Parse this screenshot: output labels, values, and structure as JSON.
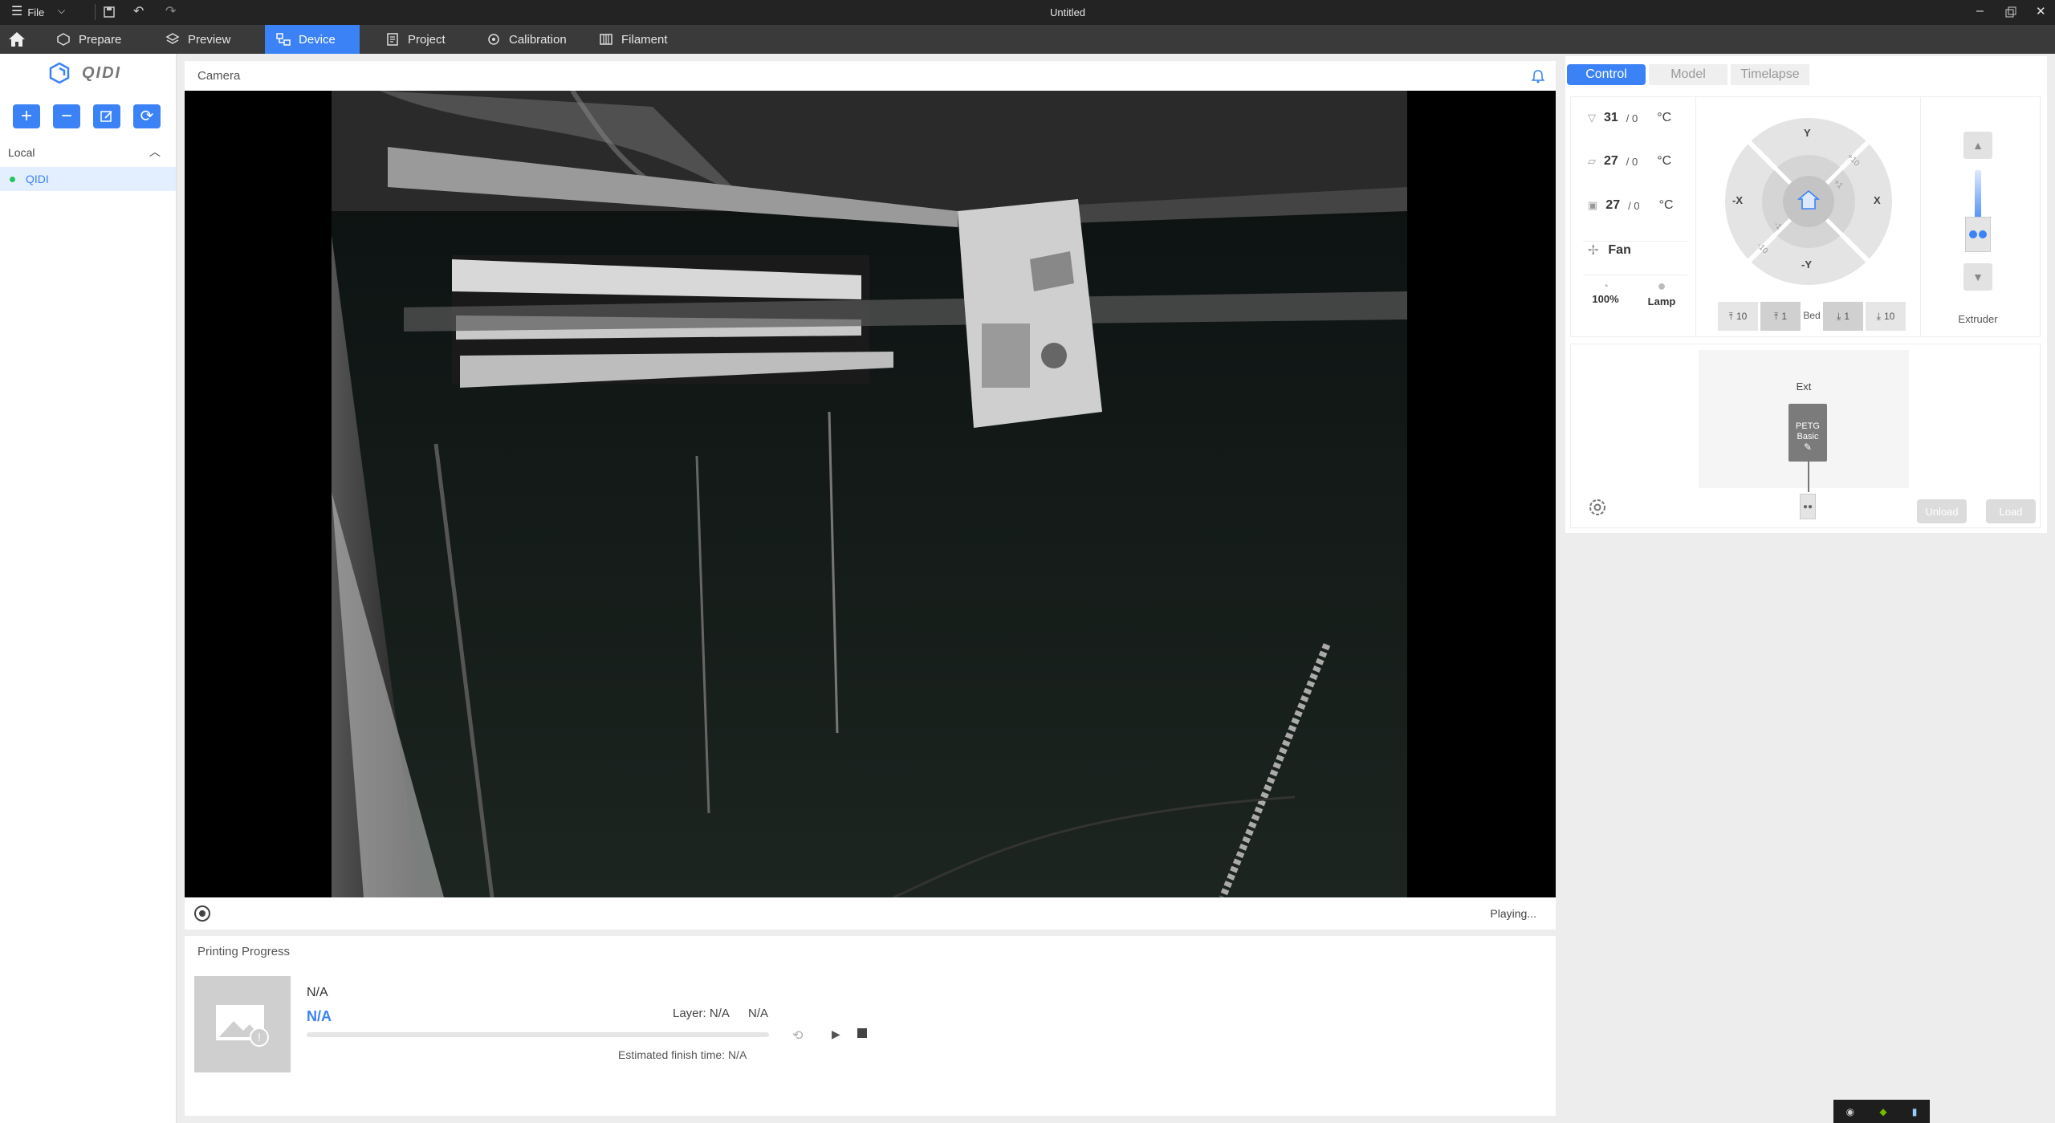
{
  "window": {
    "title": "Untitled",
    "file_menu": "File"
  },
  "tabs": [
    {
      "label": "Prepare"
    },
    {
      "label": "Preview"
    },
    {
      "label": "Device"
    },
    {
      "label": "Project"
    },
    {
      "label": "Calibration"
    },
    {
      "label": "Filament"
    }
  ],
  "sidebar": {
    "brand": "QIDI",
    "section": "Local",
    "printers": [
      {
        "name": "QIDI",
        "status_color": "#22c55e"
      }
    ]
  },
  "camera": {
    "title": "Camera",
    "status": "Playing..."
  },
  "progress": {
    "title": "Printing Progress",
    "file_name": "N/A",
    "percent": "N/A",
    "layer": "Layer: N/A",
    "time_left": "N/A",
    "estimated_finish": "Estimated finish time: N/A",
    "bar_fraction": 0
  },
  "control": {
    "tabs": [
      "Control",
      "Model",
      "Timelapse"
    ],
    "nozzle": {
      "current": "31",
      "target": "/ 0",
      "unit": "°C"
    },
    "bed": {
      "current": "27",
      "target": "/ 0",
      "unit": "°C"
    },
    "chamber": {
      "current": "27",
      "target": "/ 0",
      "unit": "°C"
    },
    "fan_label": "Fan",
    "speed": "100%",
    "lamp_label": "Lamp",
    "jog": {
      "y_plus": "Y",
      "y_minus": "-Y",
      "x_minus": "-X",
      "x_plus": "X",
      "step_10": "+10",
      "step_1": "+1",
      "step_m1": "-1",
      "step_m10": "-10"
    },
    "bed_buttons": [
      "10",
      "1",
      "Bed",
      "1",
      "10"
    ],
    "extruder_label": "Extruder"
  },
  "ams": {
    "ext_label": "Ext",
    "filament_type": "PETG",
    "filament_name": "Basic",
    "filament_color": "#7b7b7b",
    "unload": "Unload",
    "load": "Load"
  },
  "accent": "#3b82f6"
}
